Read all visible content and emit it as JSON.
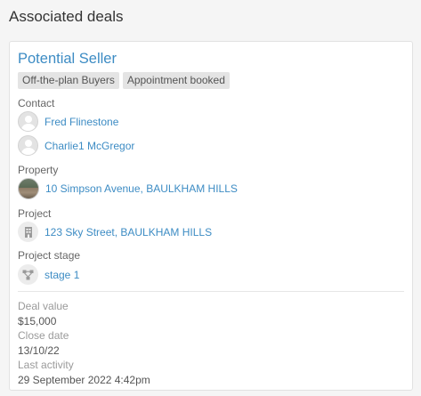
{
  "section": {
    "title": "Associated deals"
  },
  "deal": {
    "title": "Potential Seller",
    "tags": [
      "Off-the-plan Buyers",
      "Appointment booked"
    ],
    "contact_label": "Contact",
    "contacts": [
      "Fred Flinestone",
      "Charlie1 McGregor"
    ],
    "property_label": "Property",
    "property": "10 Simpson Avenue, BAULKHAM HILLS",
    "project_label": "Project",
    "project": "123 Sky Street, BAULKHAM HILLS",
    "stage_label": "Project stage",
    "stage": "stage 1",
    "deal_value_label": "Deal value",
    "deal_value": "$15,000",
    "close_date_label": "Close date",
    "close_date": "13/10/22",
    "last_activity_label": "Last activity",
    "last_activity": "29 September 2022 4:42pm"
  },
  "colors": {
    "link": "#3d8cc4",
    "tag_bg": "#e4e4e4"
  },
  "icons": {
    "contact": "user-avatar-icon",
    "property": "property-photo",
    "project": "building-icon",
    "stage": "stage-flow-icon"
  }
}
